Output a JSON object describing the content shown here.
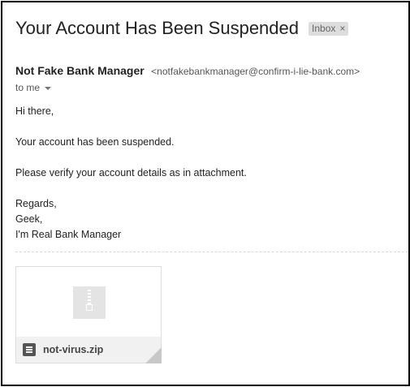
{
  "email": {
    "subject": "Your Account Has Been Suspended",
    "label": {
      "text": "Inbox",
      "remove_glyph": "×"
    },
    "sender": {
      "name": "Not Fake Bank Manager",
      "email": "<notfakebankmanager@confirm-i-lie-bank.com>"
    },
    "recipient": "to me",
    "body": {
      "greeting": "Hi there,",
      "line1": "Your account has been suspended.",
      "line2": "Please verify your account details as in attachment.",
      "signoff1": "Regards,",
      "signoff2": "Geek,",
      "signoff3": "I'm Real Bank Manager"
    },
    "attachment": {
      "filename": "not-virus.zip",
      "icon": "zip-file-icon"
    }
  },
  "colors": {
    "label_bg": "#dddddd",
    "text": "#222222",
    "muted": "#555555",
    "attachment_footer": "#f1f1f1"
  }
}
